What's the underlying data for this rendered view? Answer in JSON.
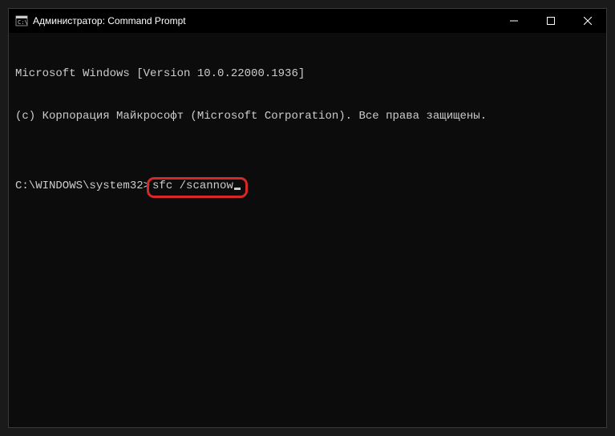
{
  "window": {
    "title": "Администратор: Command Prompt"
  },
  "terminal": {
    "line1": "Microsoft Windows [Version 10.0.22000.1936]",
    "line2": "(c) Корпорация Майкрософт (Microsoft Corporation). Все права защищены.",
    "blank": "",
    "prompt": "C:\\WINDOWS\\system32>",
    "command": "sfc /scannow"
  },
  "controls": {
    "minimize": "minimize",
    "maximize": "maximize",
    "close": "close"
  }
}
